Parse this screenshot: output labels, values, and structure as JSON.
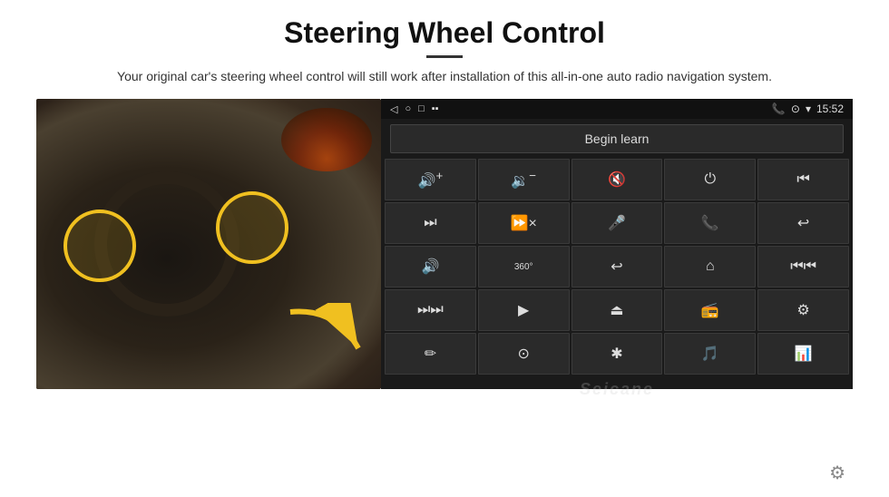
{
  "page": {
    "title": "Steering Wheel Control",
    "subtitle": "Your original car's steering wheel control will still work after installation of this all-in-one auto radio navigation system.",
    "title_divider": true
  },
  "status_bar": {
    "back_icon": "◁",
    "circle_icon": "○",
    "square_icon": "□",
    "battery_signal": "▪▪",
    "phone_icon": "📞",
    "location_icon": "⊙",
    "wifi_icon": "▾",
    "time": "15:52"
  },
  "begin_learn": {
    "label": "Begin learn"
  },
  "controls": [
    {
      "icon": "🔊+",
      "name": "vol-up"
    },
    {
      "icon": "🔉-",
      "name": "vol-down"
    },
    {
      "icon": "🔇",
      "name": "mute"
    },
    {
      "icon": "⏻",
      "name": "power"
    },
    {
      "icon": "⏭",
      "name": "prev-track"
    },
    {
      "icon": "⏭",
      "name": "next"
    },
    {
      "icon": "⏭×",
      "name": "ff-skip"
    },
    {
      "icon": "🎤",
      "name": "mic"
    },
    {
      "icon": "📞",
      "name": "call"
    },
    {
      "icon": "↩",
      "name": "hang-up"
    },
    {
      "icon": "🔊",
      "name": "speaker"
    },
    {
      "icon": "360°",
      "name": "cam360"
    },
    {
      "icon": "↩",
      "name": "back"
    },
    {
      "icon": "⌂",
      "name": "home"
    },
    {
      "icon": "⏮⏮",
      "name": "prev-prev"
    },
    {
      "icon": "⏭⏭",
      "name": "ff"
    },
    {
      "icon": "▶",
      "name": "play"
    },
    {
      "icon": "⏏",
      "name": "eject"
    },
    {
      "icon": "📻",
      "name": "radio"
    },
    {
      "icon": "⚙",
      "name": "eq"
    },
    {
      "icon": "✏",
      "name": "edit"
    },
    {
      "icon": "⊙",
      "name": "camera"
    },
    {
      "icon": "✱",
      "name": "bluetooth"
    },
    {
      "icon": "🎵",
      "name": "music"
    },
    {
      "icon": "📊",
      "name": "spectrum"
    }
  ],
  "watermark": "Seicane",
  "gear_label": "⚙"
}
